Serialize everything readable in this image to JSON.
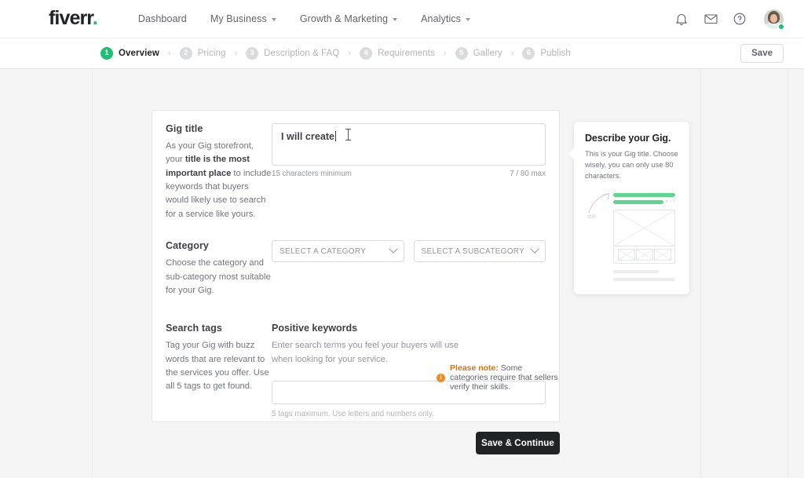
{
  "brand": {
    "logo_text": "fiverr",
    "logo_dot": ".",
    "accent_green": "#1dbf73",
    "dark": "#222325",
    "warning_orange": "#d9730d"
  },
  "topnav": {
    "links": [
      {
        "label": "Dashboard",
        "has_caret": false
      },
      {
        "label": "My Business",
        "has_caret": true
      },
      {
        "label": "Growth & Marketing",
        "has_caret": true
      },
      {
        "label": "Analytics",
        "has_caret": true
      }
    ],
    "icons": [
      {
        "name": "bell-icon"
      },
      {
        "name": "envelope-icon"
      },
      {
        "name": "help-circle-icon"
      }
    ],
    "avatar": {
      "name": "avatar",
      "presence": "online"
    }
  },
  "stepbar": {
    "steps": [
      {
        "num": "1",
        "label": "Overview",
        "active": true
      },
      {
        "num": "2",
        "label": "Pricing",
        "active": false
      },
      {
        "num": "3",
        "label": "Description & FAQ",
        "active": false
      },
      {
        "num": "4",
        "label": "Requirements",
        "active": false
      },
      {
        "num": "5",
        "label": "Gallery",
        "active": false
      },
      {
        "num": "6",
        "label": "Publish",
        "active": false
      }
    ],
    "separator": "›",
    "save_label": "Save"
  },
  "form": {
    "gig_title": {
      "title": "Gig title",
      "desc_part1": "As your Gig storefront, your ",
      "desc_bold": "title is the most important place",
      "desc_part2": " to include keywords that buyers would likely use to search for a service like yours.",
      "value": "I will create",
      "min_hint": "15 characters minimum",
      "counter": "7 / 80 max"
    },
    "category": {
      "title": "Category",
      "desc": "Choose the category and sub-category most suitable for your Gig.",
      "category_placeholder": "SELECT A CATEGORY",
      "subcategory_placeholder": "SELECT A SUBCATEGORY"
    },
    "search_tags": {
      "title": "Search tags",
      "desc": "Tag your Gig with buzz words that are relevant to the services you offer. Use all 5 tags to get found.",
      "keywords_title": "Positive keywords",
      "keywords_desc": "Enter search terms you feel your buyers will use when looking for your service.",
      "keywords_value": "",
      "tags_hint": "5 tags maximum. Use letters and numbers only."
    },
    "note": {
      "strong": "Please note:",
      "text": " Some categories require that sellers verify their skills."
    }
  },
  "tooltip": {
    "title": "Describe your Gig.",
    "desc": "This is your Gig title. Choose wisely, you can only use 80 characters.",
    "wire_label": "title",
    "wire_counter": "4 / 7"
  },
  "footer": {
    "primary_label": "Save & Continue"
  }
}
